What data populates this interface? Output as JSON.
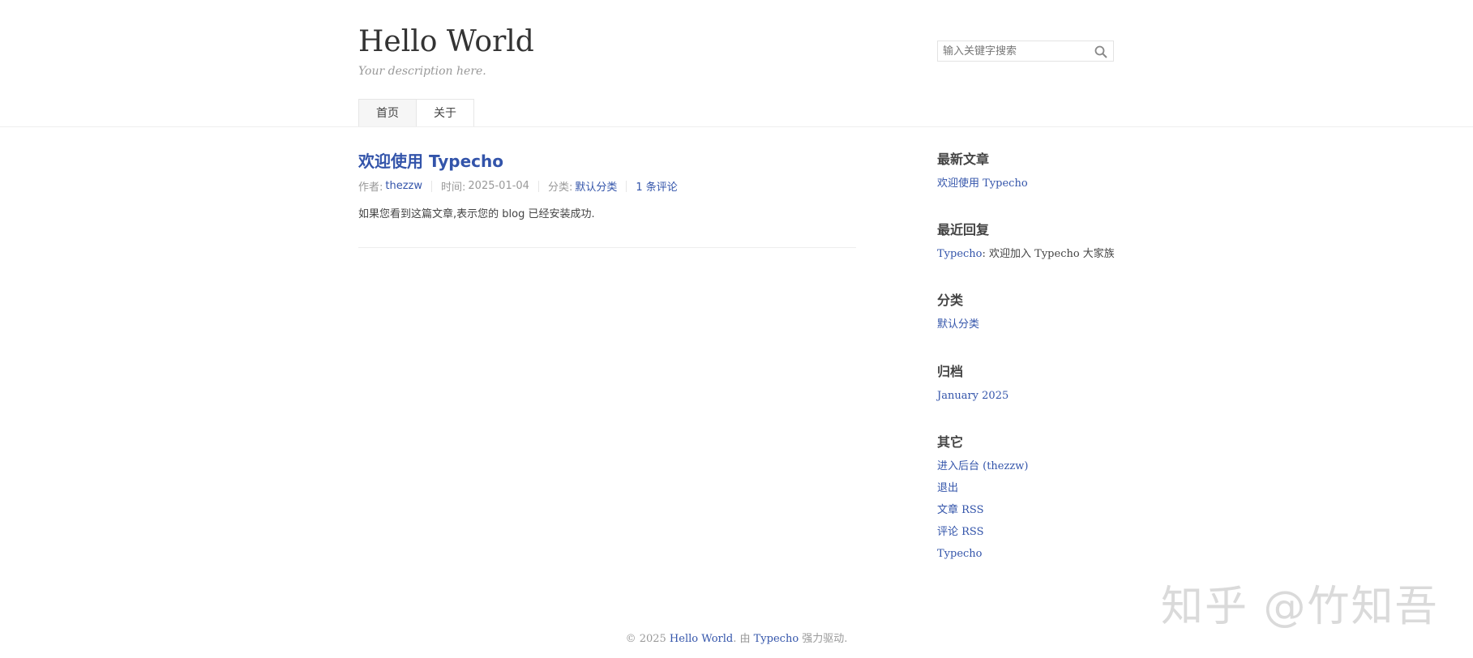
{
  "site": {
    "title": "Hello World",
    "description": "Your description here."
  },
  "search": {
    "placeholder": "输入关键字搜索"
  },
  "nav": [
    {
      "label": "首页"
    },
    {
      "label": "关于"
    }
  ],
  "post": {
    "title": "欢迎使用 Typecho",
    "meta": {
      "author_label": "作者: ",
      "author": "thezzw",
      "time_label": "时间: ",
      "time": "2025-01-04",
      "category_label": "分类: ",
      "category": "默认分类",
      "comments": "1 条评论"
    },
    "content": "如果您看到这篇文章,表示您的 blog 已经安装成功."
  },
  "sidebar": {
    "recent_posts": {
      "title": "最新文章",
      "items": [
        "欢迎使用 Typecho"
      ]
    },
    "recent_comments": {
      "title": "最近回复",
      "author": "Typecho",
      "text": ": 欢迎加入 Typecho 大家族"
    },
    "categories": {
      "title": "分类",
      "items": [
        "默认分类"
      ]
    },
    "archives": {
      "title": "归档",
      "items": [
        "January 2025"
      ]
    },
    "other": {
      "title": "其它",
      "items": [
        "进入后台 (thezzw)",
        "退出",
        "文章 RSS",
        "评论 RSS",
        "Typecho"
      ]
    }
  },
  "footer": {
    "prefix": "© 2025 ",
    "site": "Hello World",
    "middle": ". 由 ",
    "engine": "Typecho",
    "suffix": " 强力驱动."
  },
  "watermark": "知乎 @竹知吾",
  "colors": {
    "link": "#3354aa",
    "text": "#444444",
    "muted": "#999999"
  }
}
